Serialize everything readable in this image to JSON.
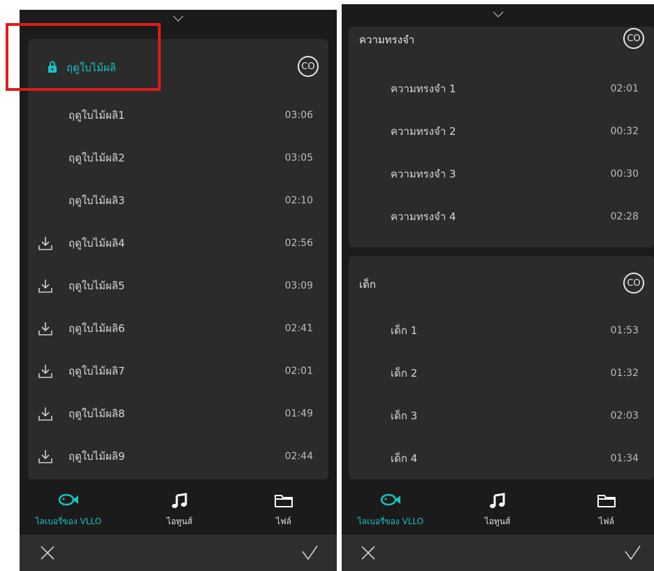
{
  "left": {
    "category": {
      "title": "ฤดูใบไม้ผลิ",
      "badge": "CO",
      "locked": true
    },
    "tracks": [
      {
        "name": "ฤดูใบไม้ผลิ1",
        "duration": "03:06",
        "download": false
      },
      {
        "name": "ฤดูใบไม้ผลิ2",
        "duration": "03:05",
        "download": false
      },
      {
        "name": "ฤดูใบไม้ผลิ3",
        "duration": "02:10",
        "download": false
      },
      {
        "name": "ฤดูใบไม้ผลิ4",
        "duration": "02:56",
        "download": true
      },
      {
        "name": "ฤดูใบไม้ผลิ5",
        "duration": "03:09",
        "download": true
      },
      {
        "name": "ฤดูใบไม้ผลิ6",
        "duration": "02:41",
        "download": true
      },
      {
        "name": "ฤดูใบไม้ผลิ7",
        "duration": "02:01",
        "download": true
      },
      {
        "name": "ฤดูใบไม้ผลิ8",
        "duration": "01:49",
        "download": true
      },
      {
        "name": "ฤดูใบไม้ผลิ9",
        "duration": "02:44",
        "download": true
      }
    ]
  },
  "right": {
    "categories": [
      {
        "title": "ความทรงจำ",
        "badge": "CO",
        "tracks": [
          {
            "name": "ความทรงจำ 1",
            "duration": "02:01"
          },
          {
            "name": "ความทรงจำ 2",
            "duration": "00:32"
          },
          {
            "name": "ความทรงจำ 3",
            "duration": "00:30"
          },
          {
            "name": "ความทรงจำ 4",
            "duration": "02:28"
          }
        ]
      },
      {
        "title": "เด็ก",
        "badge": "CO",
        "tracks": [
          {
            "name": "เด็ก 1",
            "duration": "01:53"
          },
          {
            "name": "เด็ก 2",
            "duration": "01:32"
          },
          {
            "name": "เด็ก 3",
            "duration": "02:03"
          },
          {
            "name": "เด็ก 4",
            "duration": "01:34"
          }
        ]
      }
    ]
  },
  "nav": {
    "library": "ไลเบอรี่ของ VLLO",
    "itunes": "ไอทูนส์",
    "files": "ไฟล์"
  },
  "colors": {
    "accent": "#18c2c2",
    "highlight": "#e01b1b",
    "background": "#1b1b1b",
    "card": "#2b2b2b"
  },
  "icons": [
    "chevron-down-icon",
    "lock-icon",
    "download-icon",
    "fish-icon",
    "music-note-icon",
    "folder-icon",
    "close-icon",
    "check-icon"
  ]
}
